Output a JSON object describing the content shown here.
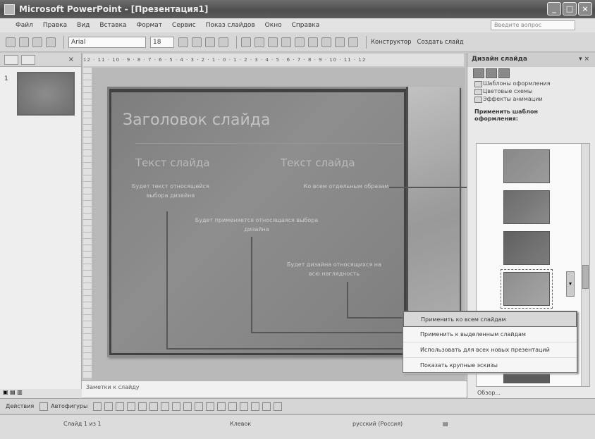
{
  "window": {
    "title": "Microsoft PowerPoint - [Презентация1]",
    "controls": [
      "_",
      "□",
      "×"
    ]
  },
  "menubar": {
    "items": [
      "Файл",
      "Правка",
      "Вид",
      "Вставка",
      "Формат",
      "Сервис",
      "Показ слайдов",
      "Окно",
      "Справка"
    ],
    "help_placeholder": "Введите вопрос"
  },
  "toolbar": {
    "font_name": "Arial",
    "font_size": "18",
    "constructor_label": "Конструктор",
    "new_slide_label": "Создать слайд"
  },
  "ruler": {
    "ticks": "12 · 11 · 10 · 9 · 8 · 7 · 6 · 5 · 4 · 3 · 2 · 1 · 0 · 1 · 2 · 3 · 4 · 5 · 6 · 7 · 8 · 9 · 10 · 11 · 12"
  },
  "outline": {
    "slide_number": "1"
  },
  "slide": {
    "title": "Заголовок слайда",
    "subtitle_left": "Текст слайда",
    "subtitle_right": "Текст слайда",
    "body_1": "Будет текст относящейся выбора дизайна",
    "body_2": "Ко всем отдельным образам",
    "body_3": "Будет применяется относящаяся выбора дизайна",
    "body_4": "Будет дизайна относящихся на всю наглядность"
  },
  "notes": {
    "placeholder": "Заметки к слайду"
  },
  "taskpane": {
    "title": "Дизайн слайда",
    "links": [
      "Шаблоны оформления",
      "Цветовые схемы",
      "Эффекты анимации"
    ],
    "section": "Применить шаблон оформления:",
    "browse": "Обзор..."
  },
  "context_menu": {
    "items": [
      "Применить ко всем слайдам",
      "Применить к выделенным слайдам",
      "Использовать для всех новых презентаций",
      "Показать крупные эскизы"
    ]
  },
  "drawbar": {
    "actions_label": "Действия",
    "autoshapes_label": "Автофигуры"
  },
  "statusbar": {
    "slide_info": "Слайд 1 из 1",
    "design": "Клевок",
    "language": "русский (Россия)"
  }
}
